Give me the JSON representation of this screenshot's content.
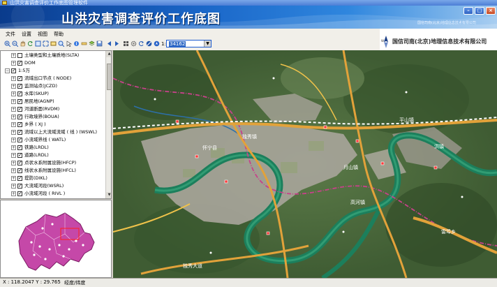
{
  "window": {
    "title": "山洪灾害调查评价工作底图管理软件"
  },
  "banner": {
    "title": "山洪灾害调查评价工作底图",
    "subtitle": "国信司南(北京)地理信息技术有限公司"
  },
  "window_controls": {
    "minimize": "–",
    "maximize": "□",
    "close": "×"
  },
  "menu": {
    "file": "文件",
    "settings": "设置",
    "view": "视图",
    "help": "帮助"
  },
  "toolbar": {
    "icons": [
      "zoom-in-icon",
      "zoom-out-icon",
      "pan-icon",
      "refresh-icon",
      "full-extent-icon",
      "zoom-extent-icon",
      "zoom-layer-icon",
      "search-icon",
      "select-icon",
      "identify-icon",
      "measure-icon",
      "layer-icon",
      "export-icon",
      "back-icon",
      "forward-icon",
      "grid-icon",
      "settings-icon",
      "refresh-view-icon",
      "stop-icon",
      "info-icon"
    ],
    "scale_prefix": "1:",
    "scale_value": "34162"
  },
  "company": {
    "name": "国信司南(北京)地理信息技术有限公司"
  },
  "layers": [
    {
      "label": "土壤类型和土壤质地(SLTA)",
      "indent": 1,
      "checked": false
    },
    {
      "label": "DOM",
      "indent": 1,
      "checked": true
    },
    {
      "label": "1:5万",
      "indent": 0,
      "checked": true,
      "expanded": true
    },
    {
      "label": "流域出口节点 ( NODE)",
      "indent": 1,
      "checked": true
    },
    {
      "label": "监测站点(JCZD)",
      "indent": 1,
      "checked": true
    },
    {
      "label": "水库(SKUP)",
      "indent": 1,
      "checked": true
    },
    {
      "label": "居民地(AGNP)",
      "indent": 1,
      "checked": true
    },
    {
      "label": "河道断面(RVDM)",
      "indent": 1,
      "checked": true
    },
    {
      "label": "行政境界(BOUA)",
      "indent": 1,
      "checked": true
    },
    {
      "label": "乡界 ( XJ )",
      "indent": 1,
      "checked": true
    },
    {
      "label": "流域以上大流域流域 ( 线 ) (WSWL)",
      "indent": 1,
      "checked": true
    },
    {
      "label": "小流域界线 ( WATL)",
      "indent": 1,
      "checked": true
    },
    {
      "label": "铁路(LRDL)",
      "indent": 1,
      "checked": true
    },
    {
      "label": "道路(LRDL)",
      "indent": 1,
      "checked": true
    },
    {
      "label": "点状水系附属设施(HFCP)",
      "indent": 1,
      "checked": true
    },
    {
      "label": "线状水系附属设施(HFCL)",
      "indent": 1,
      "checked": true
    },
    {
      "label": "堤防(DIKL)",
      "indent": 1,
      "checked": true
    },
    {
      "label": "大流域河段(WSRL)",
      "indent": 1,
      "checked": true
    },
    {
      "label": "小流域河段 ( RIVL )",
      "indent": 1,
      "checked": true
    }
  ],
  "map": {
    "labels": [
      "怀宁县",
      "独秀镇",
      "月山镇",
      "平山镇",
      "雷埠乡",
      "独秀大道",
      "高河镇",
      "洪镇"
    ]
  },
  "status": {
    "coords": "X : 118.2047  Y : 29.765",
    "unit": "经度/纬度"
  },
  "colors": {
    "banner_dark": "#0a3b8c",
    "banner_light": "#9cc7ef",
    "river": "#1c7f5c",
    "road": "#e2a23a",
    "boundary": "#c7418a",
    "railway": "#ffffff"
  }
}
